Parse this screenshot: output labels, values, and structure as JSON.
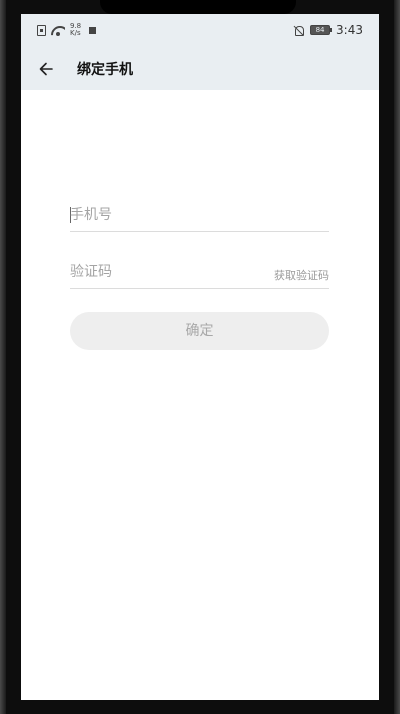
{
  "status_bar": {
    "net_speed_value": "9.8",
    "net_speed_unit": "K/s",
    "battery_level": "84",
    "time": "3:43"
  },
  "header": {
    "title": "绑定手机",
    "back_icon": "back-arrow-icon"
  },
  "form": {
    "phone_placeholder": "手机号",
    "phone_value": "",
    "code_placeholder": "验证码",
    "code_value": "",
    "get_code_label": "获取验证码",
    "confirm_label": "确定"
  },
  "colors": {
    "header_bg": "#e9eef2",
    "button_bg": "#eeeeee",
    "placeholder": "#a4a4a4"
  }
}
